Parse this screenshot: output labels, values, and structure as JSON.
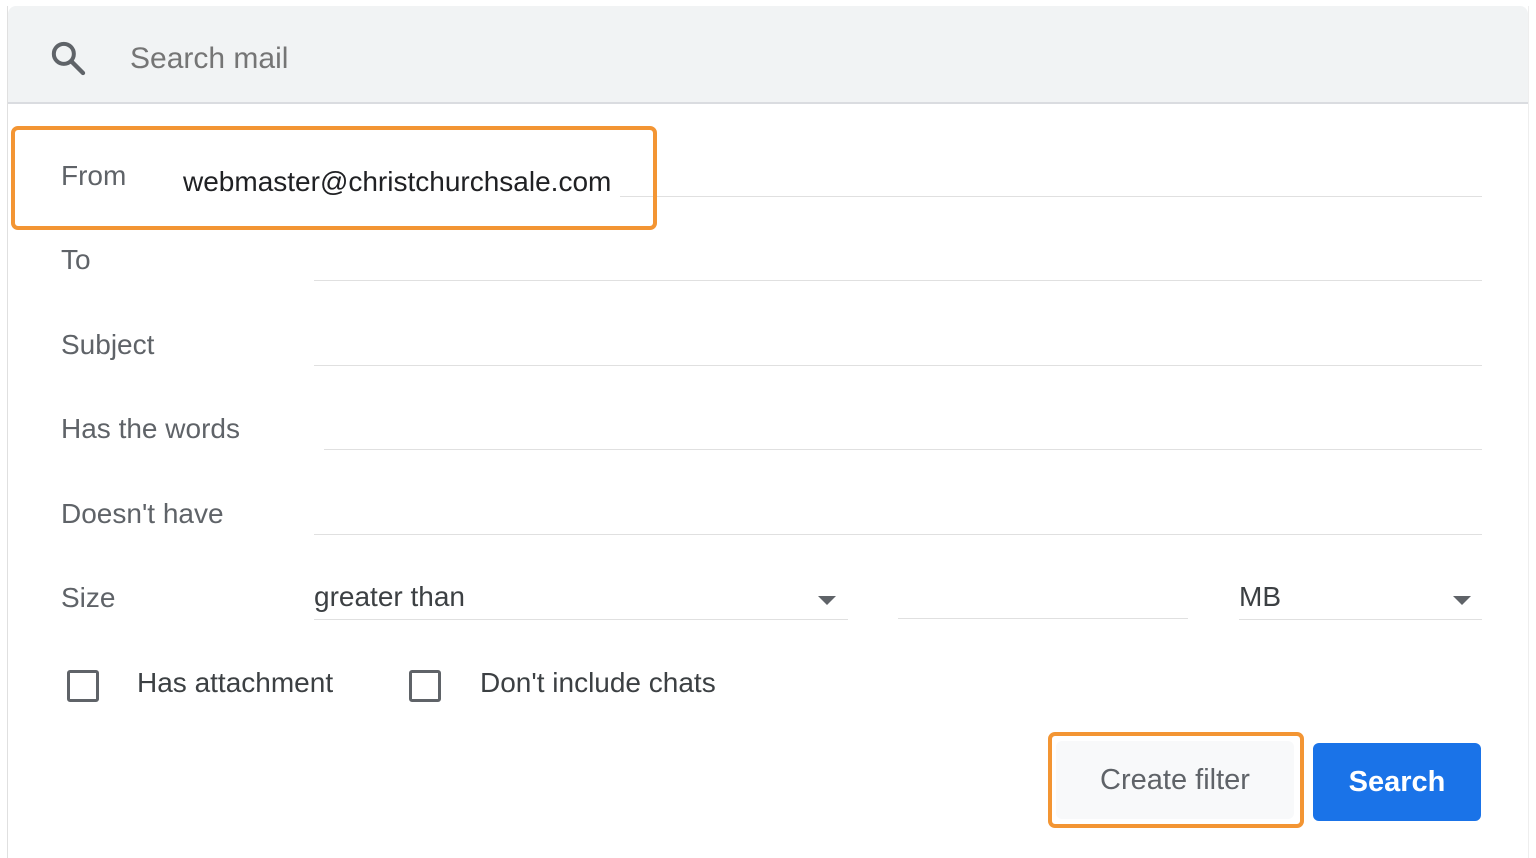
{
  "search": {
    "placeholder": "Search mail",
    "icon": "search-icon"
  },
  "form": {
    "from": {
      "label": "From",
      "value": "webmaster@christchurchsale.com"
    },
    "to": {
      "label": "To",
      "value": ""
    },
    "subject": {
      "label": "Subject",
      "value": ""
    },
    "has_words": {
      "label": "Has the words",
      "value": ""
    },
    "doesnt_have": {
      "label": "Doesn't have",
      "value": ""
    },
    "size": {
      "label": "Size",
      "comparator": "greater than",
      "amount": "",
      "unit": "MB"
    },
    "has_attachment": {
      "label": "Has attachment",
      "checked": false
    },
    "dont_include_chats": {
      "label": "Don't include chats",
      "checked": false
    }
  },
  "actions": {
    "create_filter_label": "Create filter",
    "search_label": "Search"
  },
  "colors": {
    "highlight": "#f39533",
    "primary": "#1a73e8",
    "search_bar_bg": "#f1f3f4"
  }
}
